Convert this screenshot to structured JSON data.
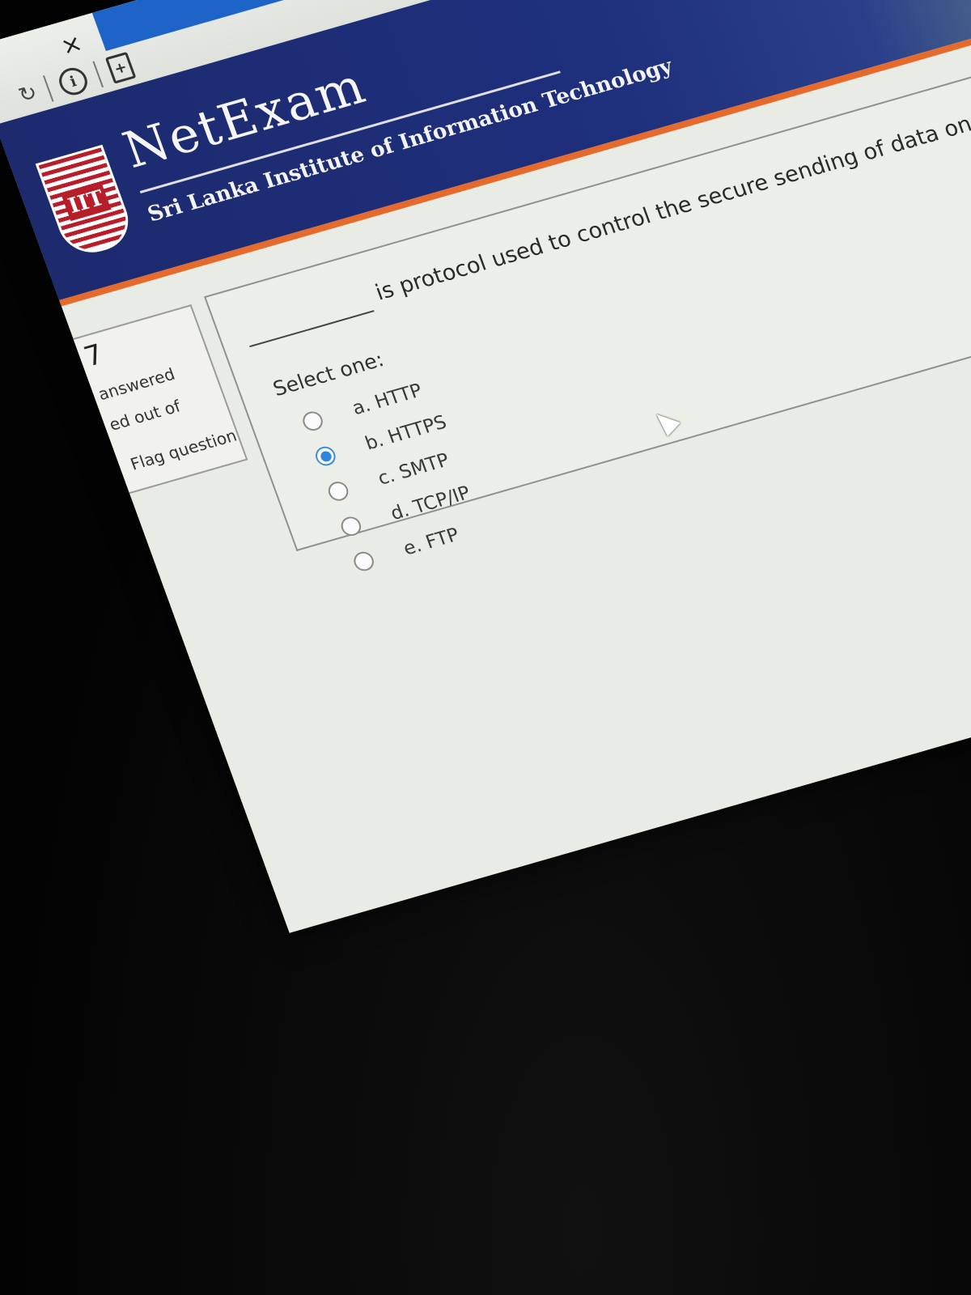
{
  "browser": {
    "close_glyph": "×",
    "info_glyph": "i",
    "page_glyph": "+"
  },
  "header": {
    "logo_text": "IIT",
    "title": "NetExam",
    "subtitle": "Sri Lanka Institute of Information Technology"
  },
  "nav": {
    "question_number": "7",
    "status": "answered",
    "marks": "ed out of",
    "flag_label": "Flag question"
  },
  "question": {
    "text": "is protocol used to control the secure sending of data on the internet.",
    "select_prompt": "Select one:",
    "options": [
      {
        "label": "a. HTTP",
        "selected": false
      },
      {
        "label": "b. HTTPS",
        "selected": true
      },
      {
        "label": "c. SMTP",
        "selected": false
      },
      {
        "label": "d. TCP/IP",
        "selected": false
      },
      {
        "label": "e. FTP",
        "selected": false
      }
    ]
  },
  "colors": {
    "header_blue": "#1e2f7c",
    "accent_orange": "#e66a2c",
    "radio_selected": "#2c86d9"
  }
}
